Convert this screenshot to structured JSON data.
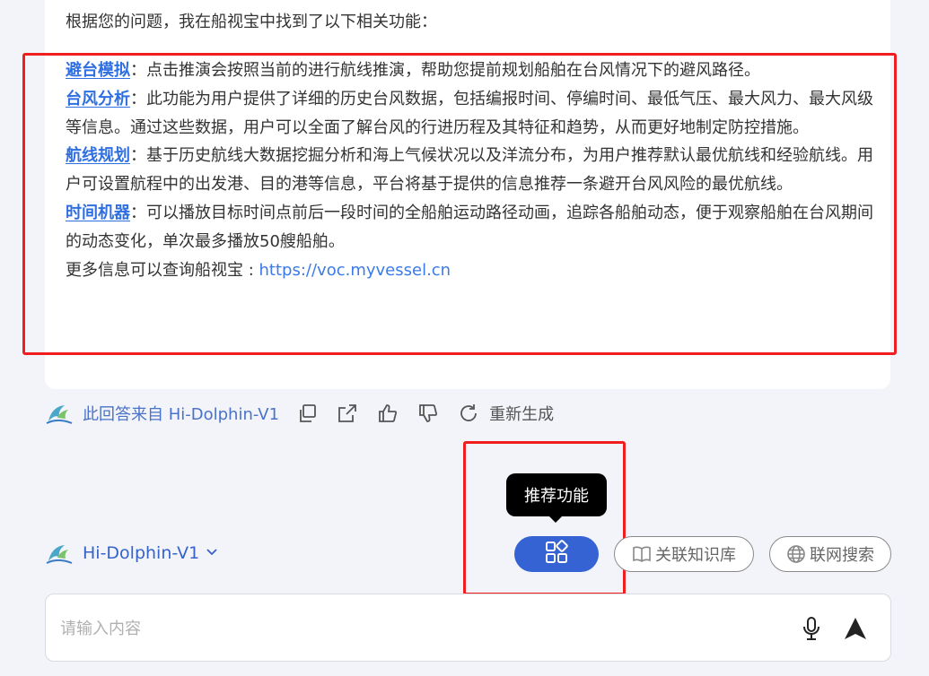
{
  "answer": {
    "intro": "根据您的问题，我在船视宝中找到了以下相关功能：",
    "features": [
      {
        "name": "避台模拟",
        "desc": "：点击推演会按照当前的进行航线推演，帮助您提前规划船舶在台风情况下的避风路径。"
      },
      {
        "name": "台风分析",
        "desc": "：此功能为用户提供了详细的历史台风数据，包括编报时间、停编时间、最低气压、最大风力、最大风级等信息。通过这些数据，用户可以全面了解台风的行进历程及其特征和趋势，从而更好地制定防控措施。"
      },
      {
        "name": "航线规划",
        "desc": "：基于历史航线大数据挖掘分析和海上气候状况以及洋流分布，为用户推荐默认最优航线和经验航线。用户可设置航程中的出发港、目的港等信息，平台将基于提供的信息推荐一条避开台风风险的最优航线。"
      },
      {
        "name": "时间机器",
        "desc": "：可以播放目标时间点前后一段时间的全船舶运动路径动画，追踪各船舶动态，便于观察船舶在台风期间的动态变化，单次最多播放50艘船舶。"
      }
    ],
    "more_prefix": "更多信息可以查询船视宝 : ",
    "more_link": "https://voc.myvessel.cn"
  },
  "footer": {
    "source": "此回答来自 Hi-Dolphin-V1",
    "regenerate": "重新生成",
    "icons": [
      "copy-icon",
      "share-icon",
      "thumbs-up-icon",
      "thumbs-down-icon",
      "refresh-icon"
    ]
  },
  "tooltip": "推荐功能",
  "model": {
    "name": "Hi-Dolphin-V1"
  },
  "toolbar": {
    "knowledge_base": "关联知识库",
    "web_search": "联网搜索"
  },
  "input": {
    "placeholder": "请输入内容"
  },
  "colors": {
    "accent": "#3563d4",
    "link": "#2f6fe0",
    "highlight": "#f01e1e"
  }
}
